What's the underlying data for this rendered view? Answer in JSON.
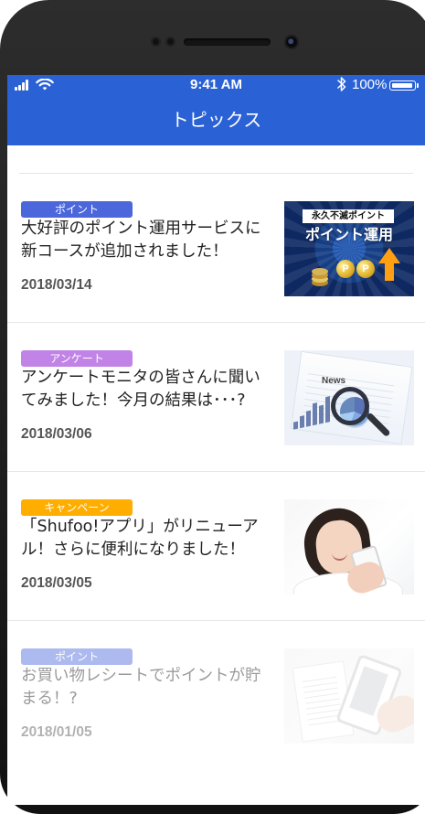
{
  "status_bar": {
    "time": "9:41 AM",
    "battery_percent": "100%",
    "battery_level": 1.0,
    "signal_bars": 4,
    "wifi": true,
    "bluetooth": true
  },
  "header": {
    "title": "トピックス",
    "color": "#2a62d6"
  },
  "articles": [
    {
      "badge": "ポイント",
      "badge_color": "#4c67dc",
      "title": "大好評のポイント運用サービスに新コースが追加されました！",
      "date": "2018/03/14",
      "image_icon": "point-operation-banner",
      "image_text_top": "永久不滅ポイント",
      "image_text_main": "ポイント運用",
      "coin_label_1": "P",
      "coin_label_2": "P",
      "faded": false
    },
    {
      "badge": "アンケート",
      "badge_color": "#c184e6",
      "title": "アンケートモニタの皆さんに聞いてみました！今月の結果は･･･?",
      "date": "2018/03/06",
      "image_icon": "survey-report-image",
      "image_text_news": "News",
      "faded": false
    },
    {
      "badge": "キャンペーン",
      "badge_color": "#ffae00",
      "title": "「Shufoo!アプリ」がリニューアル！さらに便利になりました！",
      "date": "2018/03/05",
      "image_icon": "smiling-woman-phone-image",
      "faded": false
    },
    {
      "badge": "ポイント",
      "badge_color": "#4c67dc",
      "title": "お買い物レシートでポイントが貯まる！?",
      "date": "2018/01/05",
      "image_icon": "receipt-phone-image",
      "faded": true
    }
  ]
}
